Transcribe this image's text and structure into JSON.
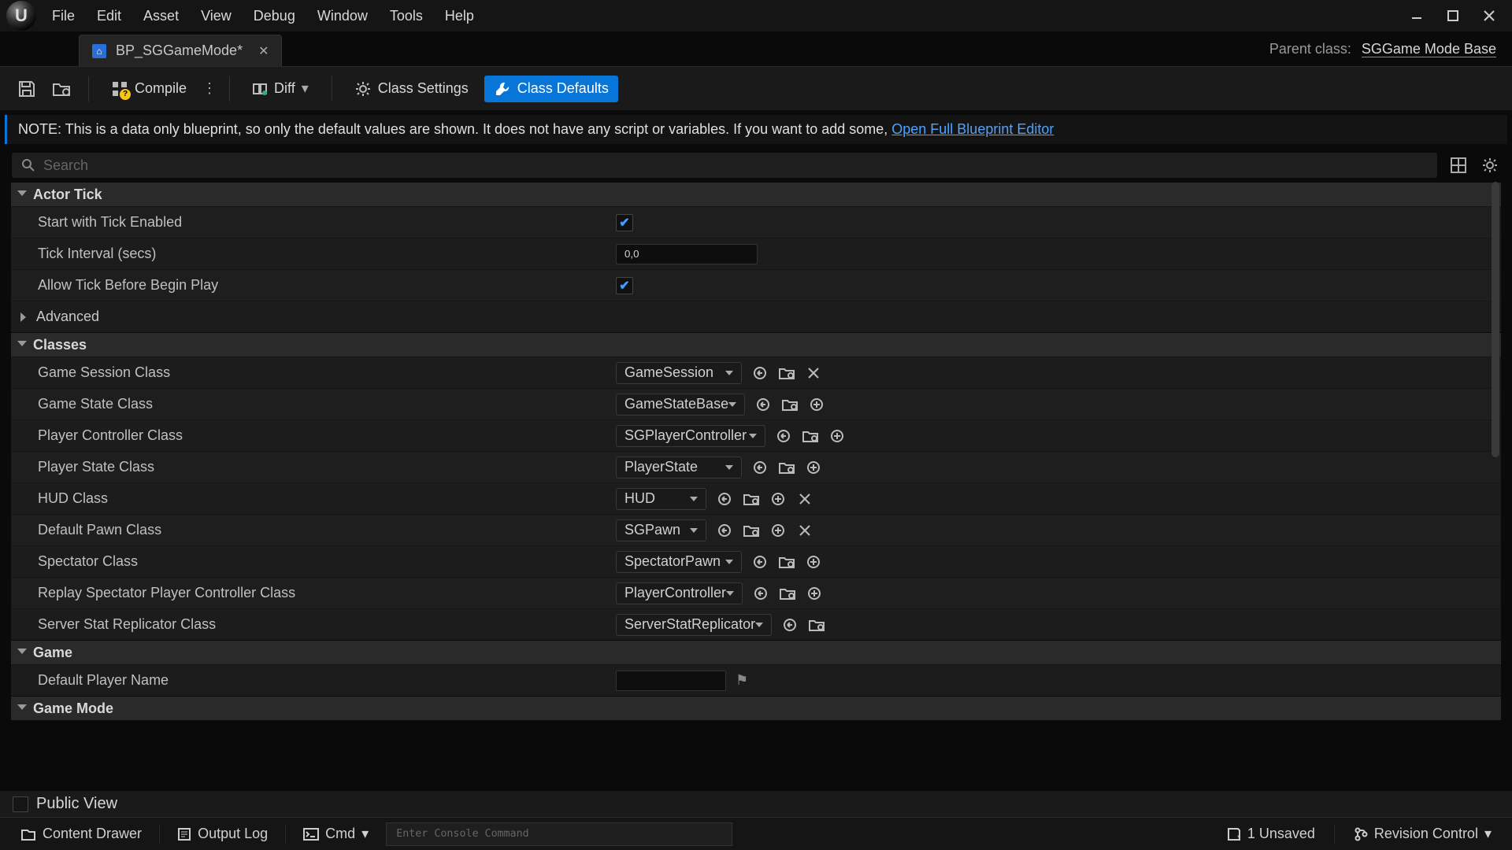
{
  "menu": {
    "items": [
      "File",
      "Edit",
      "Asset",
      "View",
      "Debug",
      "Window",
      "Tools",
      "Help"
    ]
  },
  "tab": {
    "title": "BP_SGGameMode*",
    "icon": "blueprint-icon"
  },
  "parent_class": {
    "label": "Parent class:",
    "value": "SGGame Mode Base"
  },
  "toolbar": {
    "compile": "Compile",
    "diff": "Diff",
    "class_settings": "Class Settings",
    "class_defaults": "Class Defaults"
  },
  "note": {
    "text": "NOTE: This is a data only blueprint, so only the default values are shown.  It does not have any script or variables.  If you want to add some, ",
    "link": "Open Full Blueprint Editor"
  },
  "search": {
    "placeholder": "Search"
  },
  "categories": {
    "actor_tick": {
      "title": "Actor Tick",
      "rows": {
        "start_tick": {
          "label": "Start with Tick Enabled",
          "checked": true
        },
        "tick_interval": {
          "label": "Tick Interval (secs)",
          "value": "0,0"
        },
        "allow_before": {
          "label": "Allow Tick Before Begin Play",
          "checked": true
        },
        "advanced": {
          "label": "Advanced"
        }
      }
    },
    "classes": {
      "title": "Classes",
      "rows": [
        {
          "label": "Game Session Class",
          "value": "GameSession",
          "buttons": [
            "goto",
            "browse",
            "clear"
          ]
        },
        {
          "label": "Game State Class",
          "value": "GameStateBase",
          "buttons": [
            "goto",
            "browse",
            "add"
          ]
        },
        {
          "label": "Player Controller Class",
          "value": "SGPlayerController",
          "buttons": [
            "goto",
            "browse",
            "add"
          ],
          "wide": true
        },
        {
          "label": "Player State Class",
          "value": "PlayerState",
          "buttons": [
            "goto",
            "browse",
            "add"
          ]
        },
        {
          "label": "HUD Class",
          "value": "HUD",
          "buttons": [
            "goto",
            "browse",
            "add",
            "clear"
          ],
          "narrow": true
        },
        {
          "label": "Default Pawn Class",
          "value": "SGPawn",
          "buttons": [
            "goto",
            "browse",
            "add",
            "clear"
          ],
          "narrow": true
        },
        {
          "label": "Spectator Class",
          "value": "SpectatorPawn",
          "buttons": [
            "goto",
            "browse",
            "add"
          ]
        },
        {
          "label": "Replay Spectator Player Controller Class",
          "value": "PlayerController",
          "buttons": [
            "goto",
            "browse",
            "add"
          ]
        },
        {
          "label": "Server Stat Replicator Class",
          "value": "ServerStatReplicator",
          "buttons": [
            "goto",
            "browse"
          ],
          "wide": true
        }
      ]
    },
    "game": {
      "title": "Game",
      "rows": {
        "default_player_name": {
          "label": "Default Player Name",
          "value": ""
        }
      }
    },
    "game_mode": {
      "title": "Game Mode"
    }
  },
  "public_view": {
    "label": "Public View",
    "checked": false
  },
  "statusbar": {
    "content_drawer": "Content Drawer",
    "output_log": "Output Log",
    "cmd": "Cmd",
    "cmd_placeholder": "Enter Console Command",
    "unsaved": "1 Unsaved",
    "revision": "Revision Control"
  }
}
